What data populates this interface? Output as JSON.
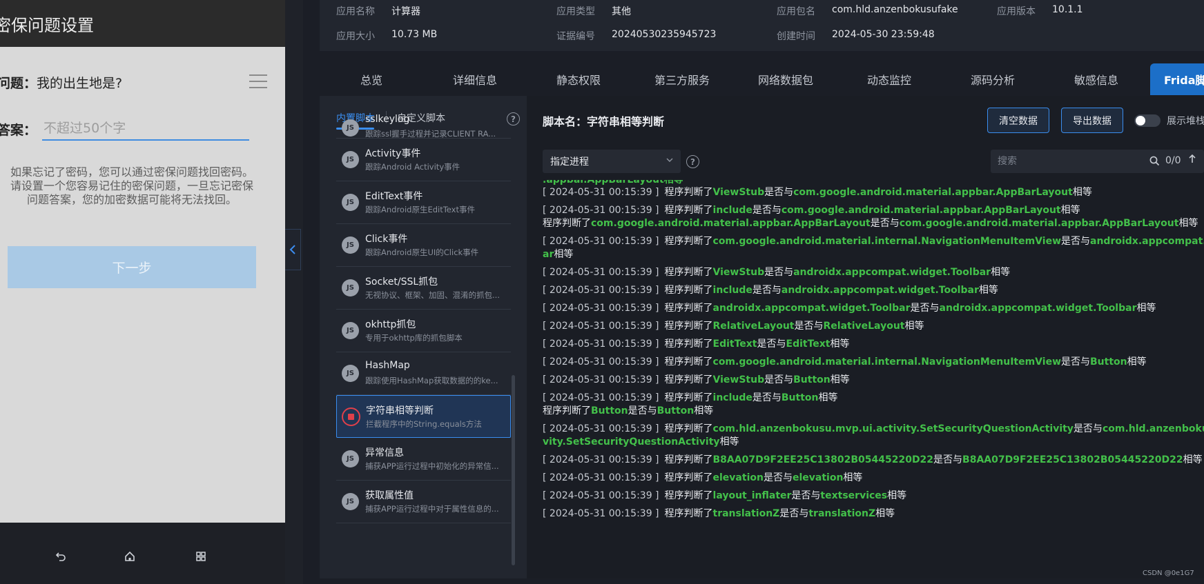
{
  "phone": {
    "title": "密保问题设置",
    "question_label": "问题：",
    "question_value": "我的出生地是?",
    "answer_label": "答案：",
    "answer_placeholder": "不超过50个字",
    "hint_lines": [
      "如果忘记了密码，您可以通过密保问题找回密码。",
      "请设置一个您容易记住的密保问题，一旦忘记密保",
      "问题答案，您的加密数据可能将无法找回。"
    ],
    "next_button": "下一步"
  },
  "app_info": {
    "name_key": "应用名称",
    "name_val": "计算器",
    "type_key": "应用类型",
    "type_val": "其他",
    "pkg_key": "应用包名",
    "pkg_val": "com.hld.anzenbokusufake",
    "ver_key": "应用版本",
    "ver_val": "10.1.1",
    "size_key": "应用大小",
    "size_val": "10.73 MB",
    "cert_key": "证据编号",
    "cert_val": "20240530235945723",
    "created_key": "创建时间",
    "created_val": "2024-05-30 23:59:48"
  },
  "tabs": [
    "总览",
    "详细信息",
    "静态权限",
    "第三方服务",
    "网络数据包",
    "动态监控",
    "源码分析",
    "敏感信息",
    "Frida脚本"
  ],
  "script_panel": {
    "tab_builtin": "内置脚本",
    "tab_custom": "自定义脚本",
    "help": "?",
    "items": [
      {
        "badge": "JS",
        "name": "sslkeylog",
        "desc": "跟踪ssl握手过程并记录CLIENT RA..."
      },
      {
        "badge": "JS",
        "name": "Activity事件",
        "desc": "跟踪Android Activity事件"
      },
      {
        "badge": "JS",
        "name": "EditText事件",
        "desc": "跟踪Android原生EditText事件"
      },
      {
        "badge": "JS",
        "name": "Click事件",
        "desc": "跟踪Android原生UI的Click事件"
      },
      {
        "badge": "JS",
        "name": "Socket/SSL抓包",
        "desc": "无视协议、框架、加固、混淆的抓包..."
      },
      {
        "badge": "JS",
        "name": "okhttp抓包",
        "desc": "专用于okhttp库的抓包脚本"
      },
      {
        "badge": "JS",
        "name": "HashMap",
        "desc": "跟踪使用HashMap获取数据的的ke..."
      },
      {
        "badge": "",
        "name": "字符串相等判断",
        "desc": "拦截程序中的String.equals方法"
      },
      {
        "badge": "JS",
        "name": "异常信息",
        "desc": "捕获APP运行过程中初始化的异常信..."
      },
      {
        "badge": "JS",
        "name": "获取属性值",
        "desc": "捕获APP运行过程中对于属性信息的..."
      }
    ]
  },
  "log_panel": {
    "script_title": "脚本名：字符串相等判断",
    "clear_button": "清空数据",
    "export_button": "导出数据",
    "stack_toggle_label": "展示堆栈",
    "process_select": "指定进程",
    "search_placeholder": "搜索",
    "search_count": "0/0",
    "lines": [
      {
        "ts": "",
        "pre": "",
        "a": "",
        "mid": "",
        "b": "",
        "post": "",
        "partial": ".appbar.AppBarLayout相等"
      },
      {
        "ts": "[ 2024-05-31 00:15:39 ]",
        "pre": "程序判断了",
        "a": "ViewStub",
        "mid": "是否与",
        "b": "com.google.android.material.appbar.AppBarLayout",
        "post": "相等"
      },
      {
        "ts": "[ 2024-05-31 00:15:39 ]",
        "pre": "程序判断了",
        "a": "include",
        "mid": "是否与",
        "b": "com.google.android.material.appbar.AppBarLayout",
        "post": "相等"
      },
      {
        "ts": "",
        "pre": "程序判断了",
        "a": "com.google.android.material.appbar.AppBarLayout",
        "mid": "是否与",
        "b": "com.google.android.material.appbar.AppBarLayout",
        "post": "相等"
      },
      {
        "ts": "[ 2024-05-31 00:15:39 ]",
        "pre": "程序判断了",
        "a": "com.google.android.material.internal.NavigationMenuItemView",
        "mid": "是否与",
        "b": "androidx.appcompat.widget.Toolb",
        "post": ""
      },
      {
        "ts": "",
        "pre": "",
        "a": "ar",
        "mid": "",
        "b": "",
        "post": "相等"
      },
      {
        "ts": "[ 2024-05-31 00:15:39 ]",
        "pre": "程序判断了",
        "a": "ViewStub",
        "mid": "是否与",
        "b": "androidx.appcompat.widget.Toolbar",
        "post": "相等"
      },
      {
        "ts": "[ 2024-05-31 00:15:39 ]",
        "pre": "程序判断了",
        "a": "include",
        "mid": "是否与",
        "b": "androidx.appcompat.widget.Toolbar",
        "post": "相等"
      },
      {
        "ts": "[ 2024-05-31 00:15:39 ]",
        "pre": "程序判断了",
        "a": "androidx.appcompat.widget.Toolbar",
        "mid": "是否与",
        "b": "androidx.appcompat.widget.Toolbar",
        "post": "相等"
      },
      {
        "ts": "[ 2024-05-31 00:15:39 ]",
        "pre": "程序判断了",
        "a": "RelativeLayout",
        "mid": "是否与",
        "b": "RelativeLayout",
        "post": "相等"
      },
      {
        "ts": "[ 2024-05-31 00:15:39 ]",
        "pre": "程序判断了",
        "a": "EditText",
        "mid": "是否与",
        "b": "EditText",
        "post": "相等"
      },
      {
        "ts": "[ 2024-05-31 00:15:39 ]",
        "pre": "程序判断了",
        "a": "com.google.android.material.internal.NavigationMenuItemView",
        "mid": "是否与",
        "b": "Button",
        "post": "相等"
      },
      {
        "ts": "[ 2024-05-31 00:15:39 ]",
        "pre": "程序判断了",
        "a": "ViewStub",
        "mid": "是否与",
        "b": "Button",
        "post": "相等"
      },
      {
        "ts": "[ 2024-05-31 00:15:39 ]",
        "pre": "程序判断了",
        "a": "include",
        "mid": "是否与",
        "b": "Button",
        "post": "相等"
      },
      {
        "ts": "",
        "pre": "程序判断了",
        "a": "Button",
        "mid": "是否与",
        "b": "Button",
        "post": "相等"
      },
      {
        "ts": "[ 2024-05-31 00:15:39 ]",
        "pre": "程序判断了",
        "a": "com.hld.anzenbokusu.mvp.ui.activity.SetSecurityQuestionActivity",
        "mid": "是否与",
        "b": "com.hld.anzenbokusu.mvp.ui.acti",
        "post": ""
      },
      {
        "ts": "",
        "pre": "",
        "a": "vity.SetSecurityQuestionActivity",
        "mid": "",
        "b": "",
        "post": "相等"
      },
      {
        "ts": "[ 2024-05-31 00:15:39 ]",
        "pre": "程序判断了",
        "a": "B8AA07D9F2EE25C13802B05445220D22",
        "mid": "是否与",
        "b": "B8AA07D9F2EE25C13802B05445220D22",
        "post": "相等"
      },
      {
        "ts": "[ 2024-05-31 00:15:39 ]",
        "pre": "程序判断了",
        "a": "elevation",
        "mid": "是否与",
        "b": "elevation",
        "post": "相等"
      },
      {
        "ts": "[ 2024-05-31 00:15:39 ]",
        "pre": "程序判断了",
        "a": "layout_inflater",
        "mid": "是否与",
        "b": "textservices",
        "post": "相等"
      },
      {
        "ts": "[ 2024-05-31 00:15:39 ]",
        "pre": "程序判断了",
        "a": "translationZ",
        "mid": "是否与",
        "b": "translationZ",
        "post": "相等"
      }
    ]
  },
  "footer_mark": "CSDN @0e1G7",
  "colors": {
    "accent": "#3a8ef0",
    "tab_active": "#1c6fc8",
    "log_green": "#43c04a",
    "stop_red": "#e0404a"
  }
}
